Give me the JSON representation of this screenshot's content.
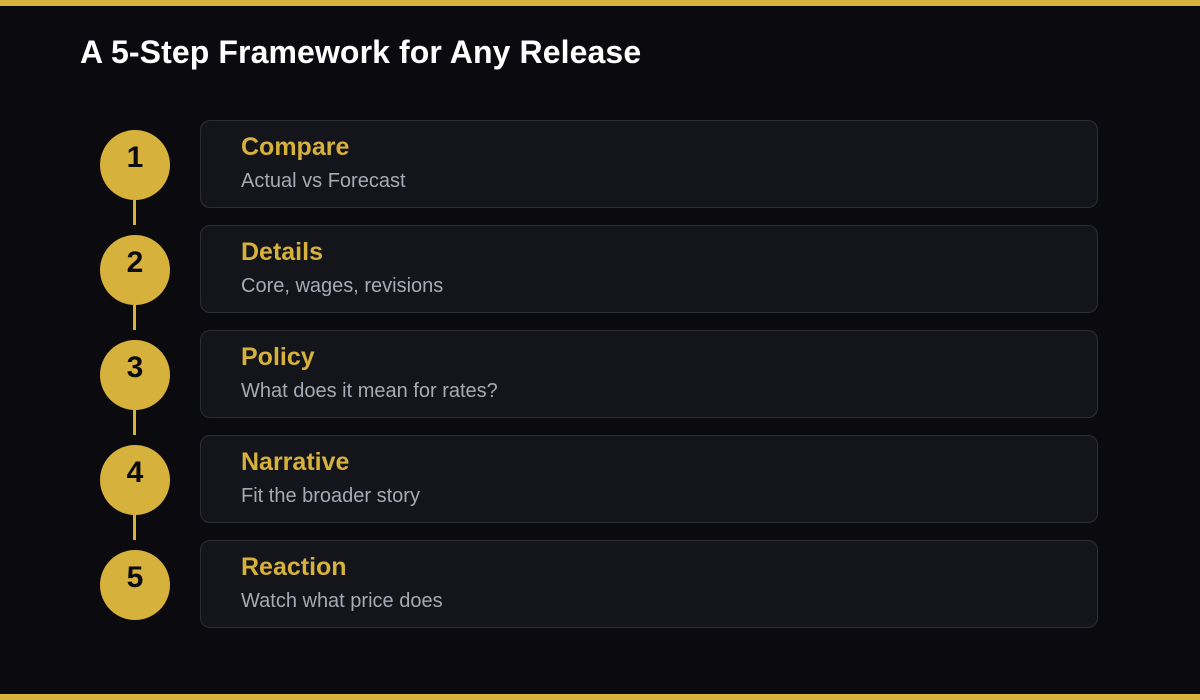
{
  "title": "A 5-Step Framework for Any Release",
  "colors": {
    "background": "#0b0b0f",
    "accent": "#d6b13c",
    "card": "#14141b",
    "card_border": "#2d2d35",
    "title_text": "#ffffff",
    "description_text": "#a7a9b4"
  },
  "steps": [
    {
      "number": "1",
      "title": "Compare",
      "description": "Actual vs Forecast"
    },
    {
      "number": "2",
      "title": "Details",
      "description": "Core, wages, revisions"
    },
    {
      "number": "3",
      "title": "Policy",
      "description": "What does it mean for rates?"
    },
    {
      "number": "4",
      "title": "Narrative",
      "description": "Fit the broader story"
    },
    {
      "number": "5",
      "title": "Reaction",
      "description": "Watch what price does"
    }
  ]
}
